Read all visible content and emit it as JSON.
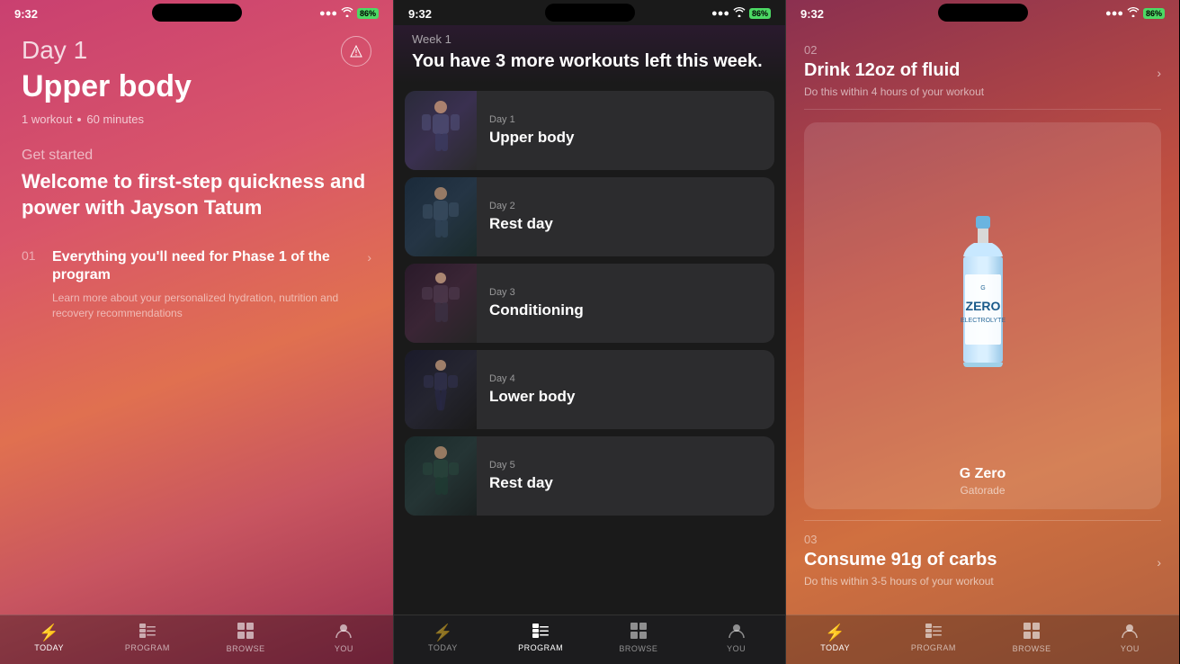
{
  "panels": [
    {
      "id": "today",
      "status": {
        "time": "9:32",
        "battery": "86%",
        "signal": "●●●",
        "wifi": "wifi"
      },
      "day_label": "Day 1",
      "workout_title": "Upper body",
      "workout_count": "1 workout",
      "workout_duration": "60 minutes",
      "get_started": "Get started",
      "description": "Welcome to first-step quickness and power with Jayson Tatum",
      "tasks": [
        {
          "number": "01",
          "title": "Everything you'll need for Phase 1 of the program",
          "subtitle": "Learn more about your personalized hydration, nutrition and recovery recommendations"
        }
      ],
      "nav": [
        {
          "label": "TODAY",
          "icon": "⚡",
          "active": true
        },
        {
          "label": "PROGRAM",
          "icon": "▦",
          "active": false
        },
        {
          "label": "BROWSE",
          "icon": "⊞",
          "active": false
        },
        {
          "label": "YOU",
          "icon": "◯",
          "active": false
        }
      ]
    },
    {
      "id": "program",
      "status": {
        "time": "9:32",
        "battery": "86%"
      },
      "week_label": "Week 1",
      "week_subtitle": "You have 3 more workouts left this week.",
      "days": [
        {
          "number": "Day 1",
          "name": "Upper body",
          "img_class": "img-upper"
        },
        {
          "number": "Day 2",
          "name": "Rest day",
          "img_class": "img-rest1"
        },
        {
          "number": "Day 3",
          "name": "Conditioning",
          "img_class": "img-cond"
        },
        {
          "number": "Day 4",
          "name": "Lower body",
          "img_class": "img-lower"
        },
        {
          "number": "Day 5",
          "name": "Rest day",
          "img_class": "img-rest2"
        }
      ],
      "nav": [
        {
          "label": "TODAY",
          "icon": "⚡",
          "active": false
        },
        {
          "label": "PROGRAM",
          "icon": "▦",
          "active": true
        },
        {
          "label": "BROWSE",
          "icon": "⊞",
          "active": false
        },
        {
          "label": "YOU",
          "icon": "◯",
          "active": false
        }
      ]
    },
    {
      "id": "nutrition",
      "status": {
        "time": "9:32",
        "battery": "86%"
      },
      "items": [
        {
          "number": "02",
          "title": "Drink 12oz of fluid",
          "subtitle": "Do this within 4 hours of your workout"
        }
      ],
      "product": {
        "name": "G Zero",
        "brand": "Gatorade"
      },
      "second_item": {
        "number": "03",
        "title": "Consume 91g of carbs",
        "subtitle": "Do this within 3-5 hours of your workout"
      },
      "nav": [
        {
          "label": "TODAY",
          "icon": "⚡",
          "active": false
        },
        {
          "label": "PROGRAM",
          "icon": "▦",
          "active": false
        },
        {
          "label": "BROWSE",
          "icon": "⊞",
          "active": false
        },
        {
          "label": "YOU",
          "icon": "◯",
          "active": false
        }
      ]
    }
  ]
}
